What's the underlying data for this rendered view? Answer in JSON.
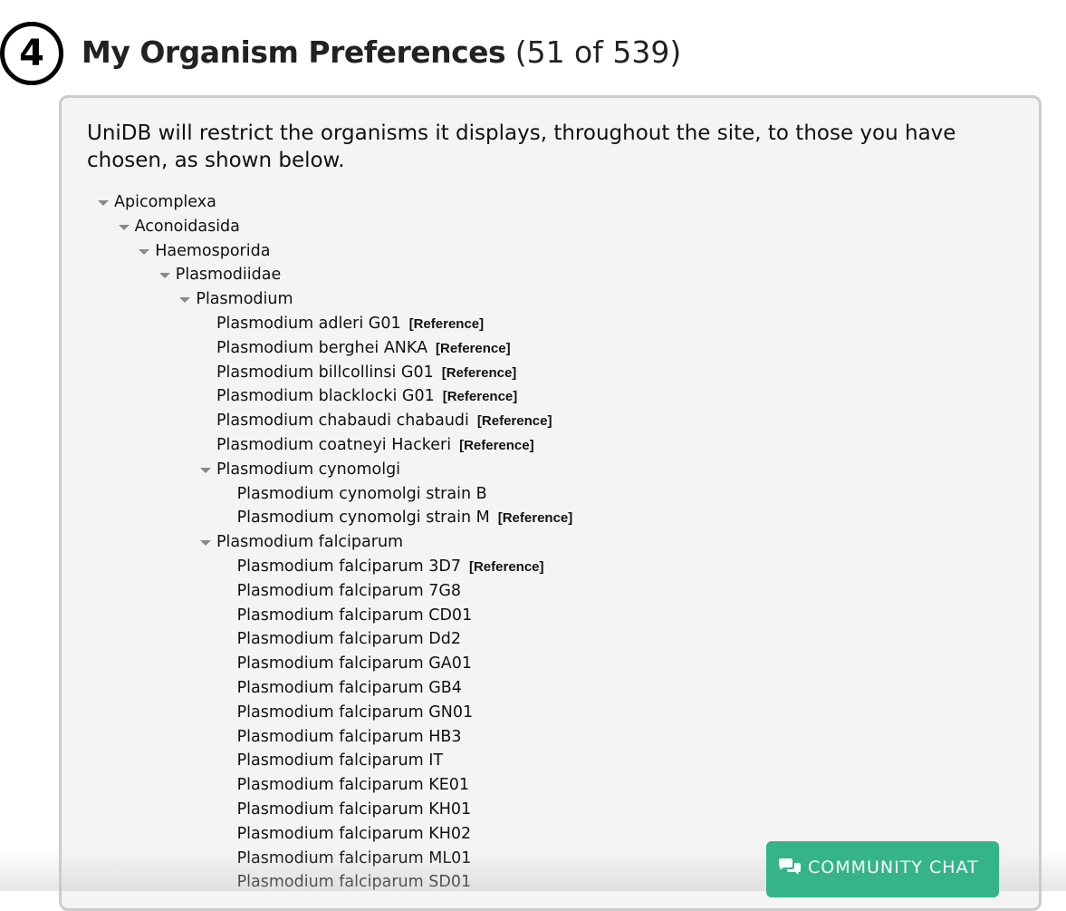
{
  "step_number": "4",
  "header": {
    "title": "My Organism Preferences",
    "count": "(51 of 539)"
  },
  "panel": {
    "intro": "UniDB will restrict the organisms it displays, throughout the site, to those you have chosen, as shown below.",
    "tree": [
      {
        "label": "Apicomplexa",
        "level": 0,
        "expanded": true
      },
      {
        "label": "Aconoidasida",
        "level": 1,
        "expanded": true
      },
      {
        "label": "Haemosporida",
        "level": 2,
        "expanded": true
      },
      {
        "label": "Plasmodiidae",
        "level": 3,
        "expanded": true
      },
      {
        "label": "Plasmodium",
        "level": 4,
        "expanded": true
      },
      {
        "label": "Plasmodium adleri G01",
        "level": 5,
        "reference": "[Reference]"
      },
      {
        "label": "Plasmodium berghei ANKA",
        "level": 5,
        "reference": "[Reference]"
      },
      {
        "label": "Plasmodium billcollinsi G01",
        "level": 5,
        "reference": "[Reference]"
      },
      {
        "label": "Plasmodium blacklocki G01",
        "level": 5,
        "reference": "[Reference]"
      },
      {
        "label": "Plasmodium chabaudi chabaudi",
        "level": 5,
        "reference": "[Reference]"
      },
      {
        "label": "Plasmodium coatneyi Hackeri",
        "level": 5,
        "reference": "[Reference]"
      },
      {
        "label": "Plasmodium cynomolgi",
        "level": 5,
        "expanded": true
      },
      {
        "label": "Plasmodium cynomolgi strain B",
        "level": 6
      },
      {
        "label": "Plasmodium cynomolgi strain M",
        "level": 6,
        "reference": "[Reference]"
      },
      {
        "label": "Plasmodium falciparum",
        "level": 5,
        "expanded": true
      },
      {
        "label": "Plasmodium falciparum 3D7",
        "level": 6,
        "reference": "[Reference]"
      },
      {
        "label": "Plasmodium falciparum 7G8",
        "level": 6
      },
      {
        "label": "Plasmodium falciparum CD01",
        "level": 6
      },
      {
        "label": "Plasmodium falciparum Dd2",
        "level": 6
      },
      {
        "label": "Plasmodium falciparum GA01",
        "level": 6
      },
      {
        "label": "Plasmodium falciparum GB4",
        "level": 6
      },
      {
        "label": "Plasmodium falciparum GN01",
        "level": 6
      },
      {
        "label": "Plasmodium falciparum HB3",
        "level": 6
      },
      {
        "label": "Plasmodium falciparum IT",
        "level": 6
      },
      {
        "label": "Plasmodium falciparum KE01",
        "level": 6
      },
      {
        "label": "Plasmodium falciparum KH01",
        "level": 6
      },
      {
        "label": "Plasmodium falciparum KH02",
        "level": 6
      },
      {
        "label": "Plasmodium falciparum ML01",
        "level": 6
      },
      {
        "label": "Plasmodium falciparum SD01",
        "level": 6
      }
    ]
  },
  "chat_button": {
    "label": "COMMUNITY CHAT",
    "icon": "chat-bubbles-icon"
  },
  "colors": {
    "chat_button": "#35b48a",
    "panel_bg": "#f4f4f4",
    "panel_border": "#cccccc",
    "caret": "#8a8a8a"
  }
}
